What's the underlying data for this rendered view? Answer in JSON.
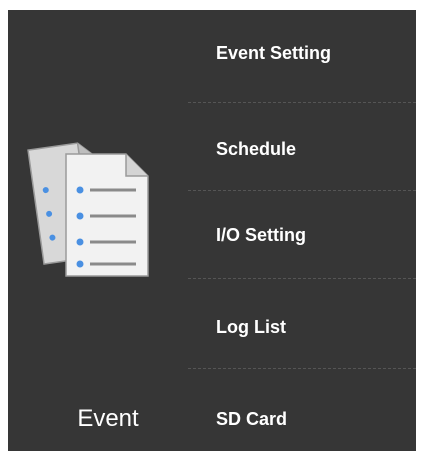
{
  "category": {
    "label": "Event",
    "icon": "document-list-icon"
  },
  "menu": {
    "items": [
      {
        "label": "Event Setting"
      },
      {
        "label": "Schedule"
      },
      {
        "label": "I/O Setting"
      },
      {
        "label": "Log List"
      },
      {
        "label": "SD Card"
      }
    ]
  },
  "colors": {
    "panel_bg": "#363636",
    "text": "#ffffff",
    "divider": "#555555",
    "bullet": "#4a90e2"
  }
}
